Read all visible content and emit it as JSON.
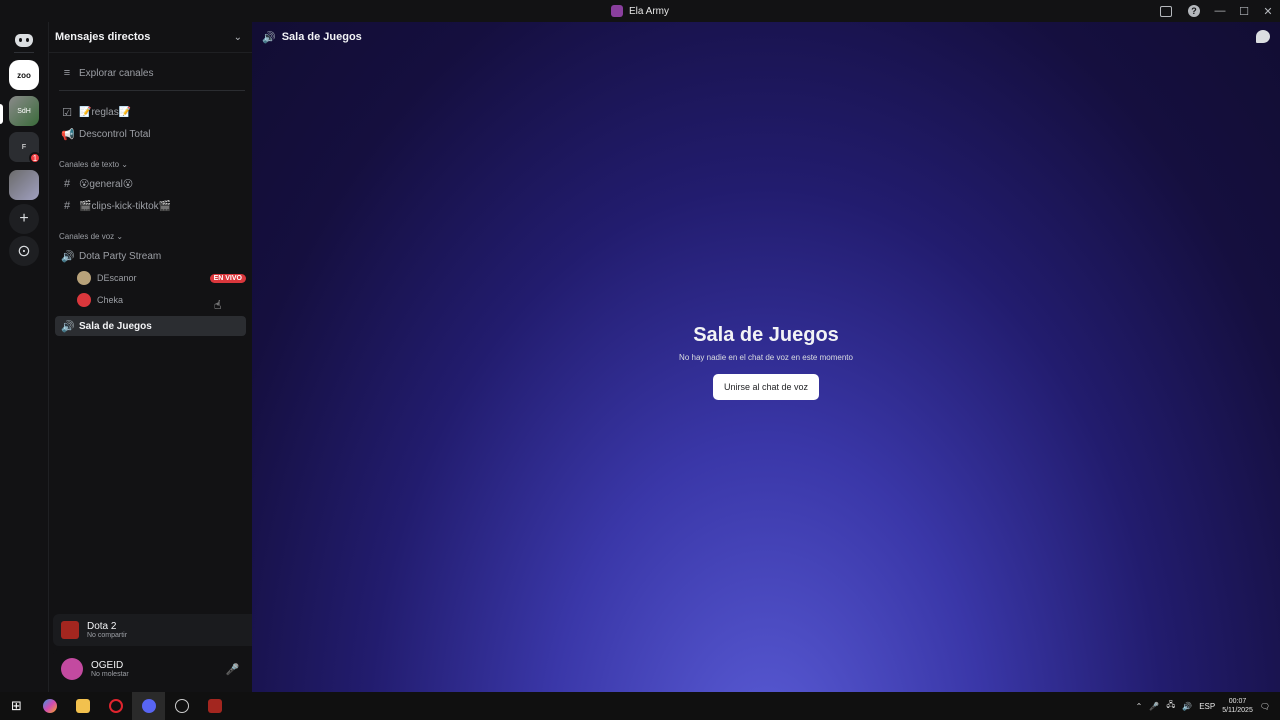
{
  "window": {
    "title": "Ela Army",
    "help_label": "?"
  },
  "servers": {
    "add_label": "+",
    "explore_label": "⊙",
    "s1_label": "zoo",
    "s2_label": "SdH",
    "s3_label": "F",
    "s3_badge": "1"
  },
  "sidebar": {
    "header": "Mensajes directos",
    "explore": "Explorar canales",
    "top_channels": [
      {
        "label": "📝reglas📝"
      },
      {
        "label": "Descontrol Total"
      }
    ],
    "text_category": "Canales de texto",
    "text_channels": [
      {
        "label": "😮general😮"
      },
      {
        "label": "🎬clips-kick-tiktok🎬"
      }
    ],
    "voice_category": "Canales de voz",
    "voice_channels": [
      {
        "label": "Dota Party Stream"
      },
      {
        "label": "Sala de Juegos"
      }
    ],
    "voice_users": [
      {
        "name": "DEscanor",
        "live": "EN VIVO"
      },
      {
        "name": "Cheka"
      }
    ]
  },
  "activity": {
    "game": "Dota 2",
    "status": "No compartir"
  },
  "user": {
    "name": "OGEID",
    "status": "No molestar"
  },
  "main": {
    "header_title": "Sala de Juegos",
    "title": "Sala de Juegos",
    "subtitle": "No hay nadie en el chat de voz en este momento",
    "join_button": "Unirse al chat de voz"
  },
  "taskbar": {
    "lang": "ESP",
    "time": "00:07",
    "date": "5/11/2025"
  },
  "colors": {
    "accent": "#5865f2",
    "live": "#da373c",
    "background": "#121214"
  }
}
